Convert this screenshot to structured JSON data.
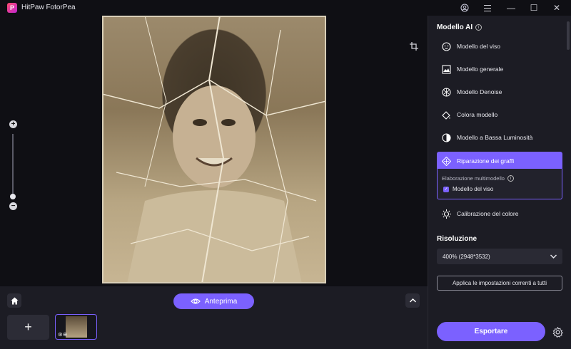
{
  "app": {
    "title": "HitPaw FotorPea"
  },
  "titlebar": {
    "account_icon": "user-circle-icon",
    "menu_icon": "hamburger-icon",
    "minimize": "—",
    "maximize": "☐",
    "close": "✕"
  },
  "canvas": {
    "crop_icon": "crop-icon",
    "zoom_plus": "+",
    "zoom_minus": "−",
    "zoom_level": 0.1
  },
  "bottombar": {
    "preview_label": "Anteprima",
    "add_label": "+",
    "collapse_label": "^"
  },
  "panel": {
    "title": "Modello AI",
    "models": [
      {
        "label": "Modello del viso",
        "icon": "face-icon"
      },
      {
        "label": "Modello generale",
        "icon": "image-icon"
      },
      {
        "label": "Modello Denoise",
        "icon": "denoise-icon"
      },
      {
        "label": "Colora modello",
        "icon": "paint-bucket-icon"
      },
      {
        "label": "Modello a Bassa Luminosità",
        "icon": "half-circle-icon"
      },
      {
        "label": "Riparazione dei graffi",
        "icon": "scratch-repair-icon"
      },
      {
        "label": "Calibrazione del colore",
        "icon": "sun-icon"
      }
    ],
    "active_model": "Riparazione dei graffi",
    "sub": {
      "label": "Elaborazione multimodello",
      "checkbox_label": "Modello del viso",
      "checked": true
    },
    "resolution": {
      "title": "Risoluzione",
      "value": "400% (2948*3532)"
    },
    "apply_label": "Applica le impostazioni correnti a tutti",
    "export_label": "Esportare"
  },
  "colors": {
    "accent": "#7b61ff",
    "panel_bg": "#1c1c24",
    "app_bg": "#0f0f14"
  }
}
